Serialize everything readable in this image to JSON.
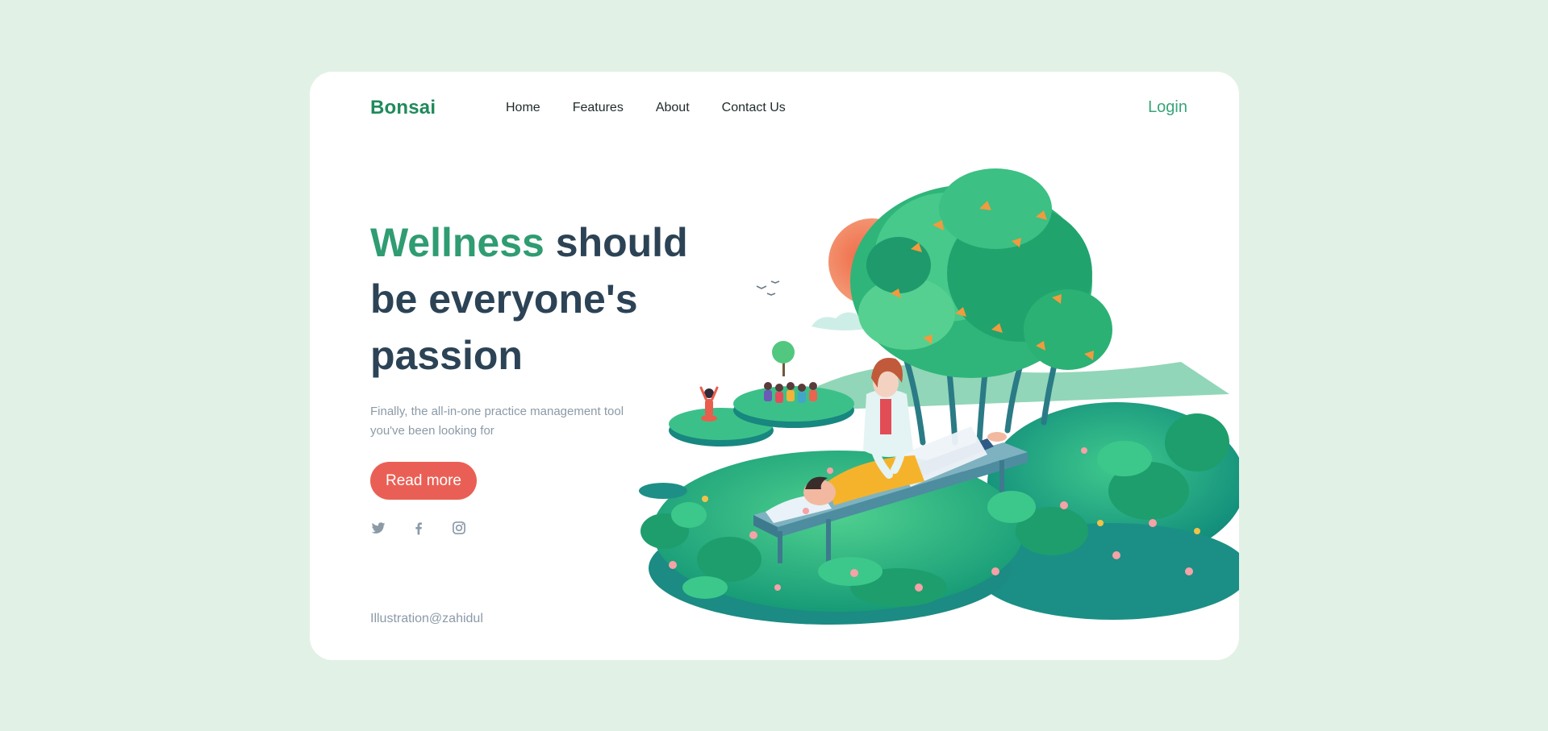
{
  "brand": {
    "name": "Bonsai"
  },
  "nav": {
    "items": [
      "Home",
      "Features",
      "About",
      "Contact Us"
    ],
    "login": "Login"
  },
  "hero": {
    "title_accent": "Wellness",
    "title_rest": " should be everyone's passion",
    "subtitle": "Finally, the all-in-one practice management tool you've been looking for",
    "cta": "Read more"
  },
  "socials": [
    "twitter-icon",
    "facebook-icon",
    "instagram-icon"
  ],
  "credit": "Illustration@zahidul",
  "colors": {
    "background": "#e2f1e6",
    "brand": "#1f8a5a",
    "accent": "#2f9c72",
    "heading": "#2c4356",
    "cta": "#ea5f55",
    "muted": "#8b9aa7"
  }
}
